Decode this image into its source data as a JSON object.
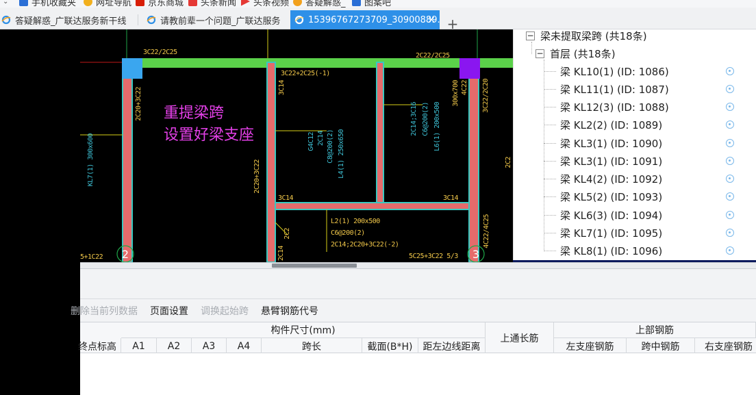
{
  "favorites": [
    {
      "label": "手机收藏夹",
      "icon": "folder-icon",
      "color": "#2b6fd6"
    },
    {
      "label": "网址导航",
      "icon": "navigation-icon",
      "color": "#f2b01e"
    },
    {
      "label": "京东商城",
      "icon": "jd-icon",
      "color": "#d81e06"
    },
    {
      "label": "头条新闻",
      "icon": "news-icon",
      "color": "#e53935"
    },
    {
      "label": "头条视频",
      "icon": "video-icon",
      "color": "#e53935"
    },
    {
      "label": "答疑解惑_",
      "icon": "ie-icon",
      "color": "#f2a11e"
    },
    {
      "label": "图案吧",
      "icon": "image-icon",
      "color": "#2b6fd6"
    }
  ],
  "tabs": [
    {
      "label": "答疑解惑_广联达服务新干线",
      "active": false
    },
    {
      "label": "请教前辈一个问题_广联达服务",
      "active": false
    },
    {
      "label": "15396767273709_30900889...",
      "active": true,
      "close": "×"
    }
  ],
  "new_tab": "+",
  "cad": {
    "annotation_line1": "重提梁跨",
    "annotation_line2": "设置好梁支座",
    "axis_labels": [
      "2",
      "3"
    ],
    "labels": {
      "top_left": "3C22/2C25",
      "top_mid": "3C22+2C25(-1)",
      "top_right": "2C22/2C25",
      "col_left": "2C20+3C22",
      "col_left_b": "3C14",
      "beam_l4": "L4(1) 250x650",
      "beam_l4_b": "C8@200(2)",
      "beam_l4_c": "2C14",
      "beam_l4_d": "G4C12",
      "beam_l6": "L6(1) 200x500",
      "beam_l6_b": "C6@200(2)",
      "beam_l6_c": "2C14;3C16",
      "beam_mid_v": "2C20+3C22",
      "kl_right": "4C22",
      "kl_right_b": "300x700",
      "kl_right_c": "3C22/2C20",
      "kl_left": "KL7(1) 300x600",
      "mid_low": "3C14",
      "mid_low2": "3C14",
      "l2_a": "L2(1) 200x500",
      "l2_b": "C6@200(2)",
      "l2_c": "2C14;2C20+3C22(-2)",
      "left_2c2": "2C2",
      "left_2c2b": "2C14",
      "bottom_right": "5C25+3C22 5/3",
      "bottom_left": "5+1C22",
      "right_edge": "4C22/4C25",
      "right_edge2": "2C2"
    }
  },
  "tree": {
    "root_toggle": "−",
    "root_label": "梁未提取梁跨 (共18条)",
    "floor_toggle": "−",
    "floor_label": "首层 (共18条)",
    "items": [
      {
        "label": "梁 KL10(1) (ID: 1086)"
      },
      {
        "label": "梁 KL11(1) (ID: 1087)"
      },
      {
        "label": "梁 KL12(3) (ID: 1088)"
      },
      {
        "label": "梁 KL2(2) (ID: 1089)"
      },
      {
        "label": "梁 KL3(1) (ID: 1090)"
      },
      {
        "label": "梁 KL3(1) (ID: 1091)"
      },
      {
        "label": "梁 KL4(2) (ID: 1092)"
      },
      {
        "label": "梁 KL5(2) (ID: 1093)"
      },
      {
        "label": "梁 KL6(3) (ID: 1094)"
      },
      {
        "label": "梁 KL7(1) (ID: 1095)"
      },
      {
        "label": "梁 KL8(1) (ID: 1096)"
      }
    ]
  },
  "toolbar": {
    "delete_column": "删除当前列数据",
    "page_setup": "页面设置",
    "swap_start_span": "调换起始跨",
    "cantilever_code": "悬臂钢筋代号"
  },
  "table": {
    "group_size": "构件尺寸(mm)",
    "top_through": "上通长筋",
    "group_top_rebar": "上部钢筋",
    "end_elev": "终点标高",
    "a1": "A1",
    "a2": "A2",
    "a3": "A3",
    "a4": "A4",
    "span_len": "跨长",
    "section": "截面(B*H)",
    "dist_left": "距左边线距离",
    "left_support": "左支座钢筋",
    "mid_span": "跨中钢筋",
    "right_support": "右支座钢筋"
  },
  "colors": {
    "tab_active": "#2e90e8",
    "beam_fill": "#e56b6b",
    "beam_edge": "#39c8c0",
    "top_beam": "#5bd14a",
    "annotation": "#e23fe6",
    "column_blue": "#3aa6ef",
    "column_purple": "#8a16f0"
  }
}
